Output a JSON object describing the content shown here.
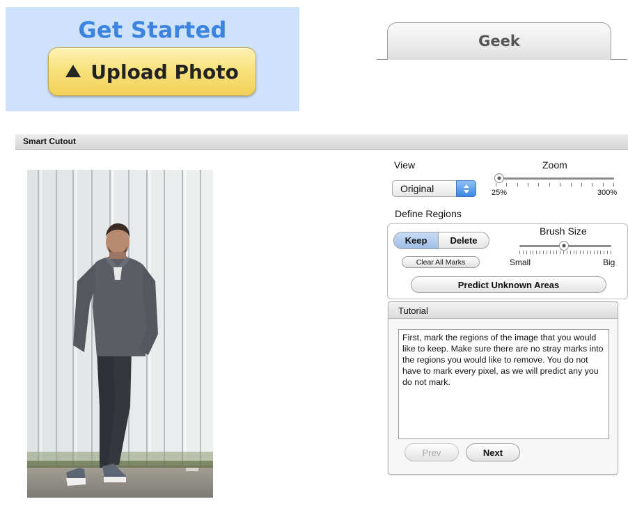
{
  "get_started": {
    "title": "Get Started",
    "upload_label": "Upload Photo",
    "upload_icon": "upload-triangle-icon",
    "background": "#cfe2fb",
    "title_color": "#3d84e0"
  },
  "tabs": [
    {
      "label": "Geek",
      "selected": true
    }
  ],
  "window": {
    "title": "Smart Cutout"
  },
  "view": {
    "label": "View",
    "selected": "Original"
  },
  "zoom": {
    "label": "Zoom",
    "min_label": "25%",
    "max_label": "300%",
    "value": "25%"
  },
  "define_regions": {
    "label": "Define Regions",
    "keep_label": "Keep",
    "delete_label": "Delete",
    "selected": "Keep",
    "clear_label": "Clear All Marks",
    "predict_label": "Predict Unknown Areas"
  },
  "brush": {
    "label": "Brush Size",
    "min_label": "Small",
    "max_label": "Big",
    "value_fraction": 0.47
  },
  "tutorial": {
    "title": "Tutorial",
    "text": "First, mark the regions of the image that you would like to keep.  Make sure there are no stray marks into the regions you would like to remove.  You do not have to mark every pixel, as we will predict any you do not mark.",
    "prev_label": "Prev",
    "next_label": "Next"
  },
  "colors": {
    "accent_blue": "#3b86e2",
    "keep_selected": "#b5cdee",
    "upload_yellow": "#f8e27e"
  }
}
